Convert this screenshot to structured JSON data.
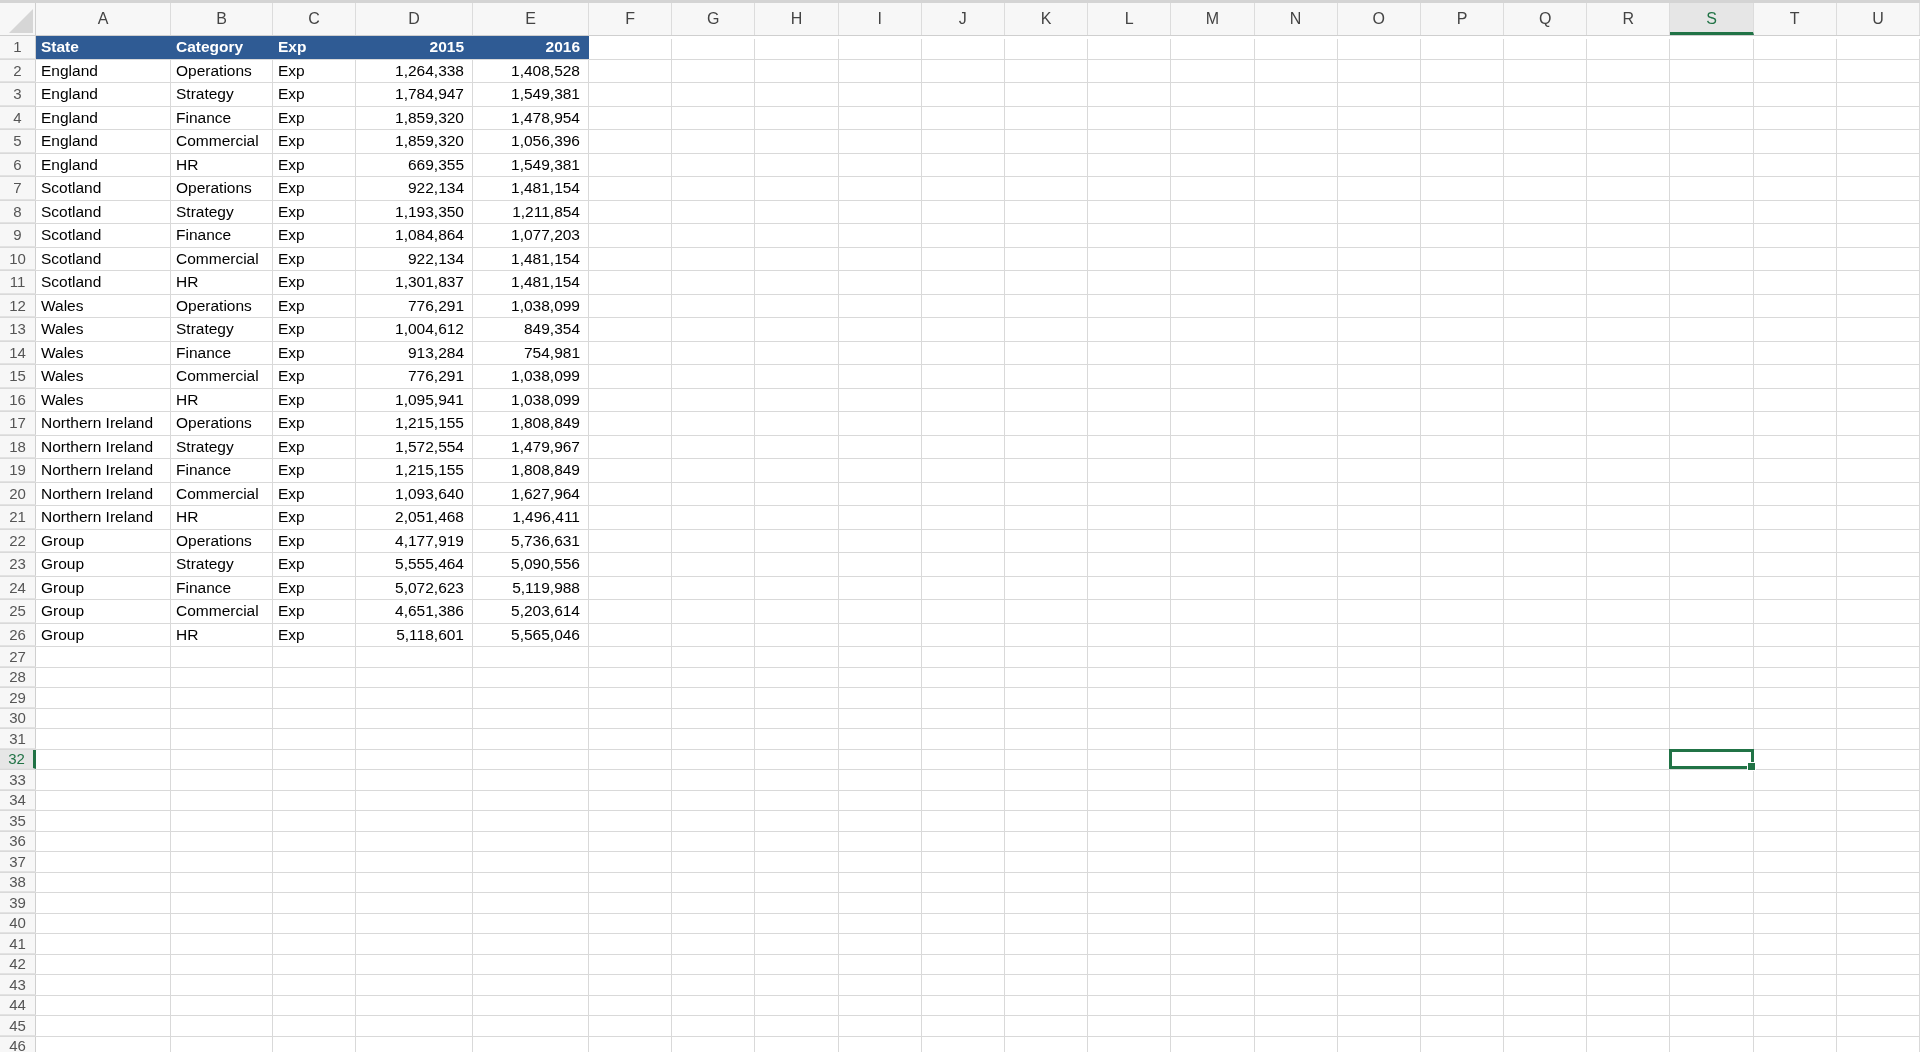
{
  "columns": [
    {
      "label": "A",
      "selected": false
    },
    {
      "label": "B",
      "selected": false
    },
    {
      "label": "C",
      "selected": false
    },
    {
      "label": "D",
      "selected": false
    },
    {
      "label": "E",
      "selected": false
    },
    {
      "label": "F",
      "selected": false
    },
    {
      "label": "G",
      "selected": false
    },
    {
      "label": "H",
      "selected": false
    },
    {
      "label": "I",
      "selected": false
    },
    {
      "label": "J",
      "selected": false
    },
    {
      "label": "K",
      "selected": false
    },
    {
      "label": "L",
      "selected": false
    },
    {
      "label": "M",
      "selected": false
    },
    {
      "label": "N",
      "selected": false
    },
    {
      "label": "O",
      "selected": false
    },
    {
      "label": "P",
      "selected": false
    },
    {
      "label": "Q",
      "selected": false
    },
    {
      "label": "R",
      "selected": false
    },
    {
      "label": "S",
      "selected": true
    },
    {
      "label": "T",
      "selected": false
    },
    {
      "label": "U",
      "selected": false
    }
  ],
  "rows": [
    {
      "number": "1",
      "selected": false,
      "kind": "header",
      "cells": [
        "State",
        "Category",
        "Exp",
        "2015",
        "2016"
      ]
    },
    {
      "number": "2",
      "selected": false,
      "kind": "data",
      "cells": [
        "England",
        "Operations",
        "Exp",
        "1,264,338",
        "1,408,528"
      ]
    },
    {
      "number": "3",
      "selected": false,
      "kind": "data",
      "cells": [
        "England",
        "Strategy",
        "Exp",
        "1,784,947",
        "1,549,381"
      ]
    },
    {
      "number": "4",
      "selected": false,
      "kind": "data",
      "cells": [
        "England",
        "Finance",
        "Exp",
        "1,859,320",
        "1,478,954"
      ]
    },
    {
      "number": "5",
      "selected": false,
      "kind": "data",
      "cells": [
        "England",
        "Commercial",
        "Exp",
        "1,859,320",
        "1,056,396"
      ]
    },
    {
      "number": "6",
      "selected": false,
      "kind": "data",
      "cells": [
        "England",
        "HR",
        "Exp",
        "669,355",
        "1,549,381"
      ]
    },
    {
      "number": "7",
      "selected": false,
      "kind": "data",
      "cells": [
        "Scotland",
        "Operations",
        "Exp",
        "922,134",
        "1,481,154"
      ]
    },
    {
      "number": "8",
      "selected": false,
      "kind": "data",
      "cells": [
        "Scotland",
        "Strategy",
        "Exp",
        "1,193,350",
        "1,211,854"
      ]
    },
    {
      "number": "9",
      "selected": false,
      "kind": "data",
      "cells": [
        "Scotland",
        "Finance",
        "Exp",
        "1,084,864",
        "1,077,203"
      ]
    },
    {
      "number": "10",
      "selected": false,
      "kind": "data",
      "cells": [
        "Scotland",
        "Commercial",
        "Exp",
        "922,134",
        "1,481,154"
      ]
    },
    {
      "number": "11",
      "selected": false,
      "kind": "data",
      "cells": [
        "Scotland",
        "HR",
        "Exp",
        "1,301,837",
        "1,481,154"
      ]
    },
    {
      "number": "12",
      "selected": false,
      "kind": "data",
      "cells": [
        "Wales",
        "Operations",
        "Exp",
        "776,291",
        "1,038,099"
      ]
    },
    {
      "number": "13",
      "selected": false,
      "kind": "data",
      "cells": [
        "Wales",
        "Strategy",
        "Exp",
        "1,004,612",
        "849,354"
      ]
    },
    {
      "number": "14",
      "selected": false,
      "kind": "data",
      "cells": [
        "Wales",
        "Finance",
        "Exp",
        "913,284",
        "754,981"
      ]
    },
    {
      "number": "15",
      "selected": false,
      "kind": "data",
      "cells": [
        "Wales",
        "Commercial",
        "Exp",
        "776,291",
        "1,038,099"
      ]
    },
    {
      "number": "16",
      "selected": false,
      "kind": "data",
      "cells": [
        "Wales",
        "HR",
        "Exp",
        "1,095,941",
        "1,038,099"
      ]
    },
    {
      "number": "17",
      "selected": false,
      "kind": "data",
      "cells": [
        "Northern Ireland",
        "Operations",
        "Exp",
        "1,215,155",
        "1,808,849"
      ]
    },
    {
      "number": "18",
      "selected": false,
      "kind": "data",
      "cells": [
        "Northern Ireland",
        "Strategy",
        "Exp",
        "1,572,554",
        "1,479,967"
      ]
    },
    {
      "number": "19",
      "selected": false,
      "kind": "data",
      "cells": [
        "Northern Ireland",
        "Finance",
        "Exp",
        "1,215,155",
        "1,808,849"
      ]
    },
    {
      "number": "20",
      "selected": false,
      "kind": "data",
      "cells": [
        "Northern Ireland",
        "Commercial",
        "Exp",
        "1,093,640",
        "1,627,964"
      ]
    },
    {
      "number": "21",
      "selected": false,
      "kind": "data",
      "cells": [
        "Northern Ireland",
        "HR",
        "Exp",
        "2,051,468",
        "1,496,411"
      ]
    },
    {
      "number": "22",
      "selected": false,
      "kind": "data",
      "cells": [
        "Group",
        "Operations",
        "Exp",
        "4,177,919",
        "5,736,631"
      ]
    },
    {
      "number": "23",
      "selected": false,
      "kind": "data",
      "cells": [
        "Group",
        "Strategy",
        "Exp",
        "5,555,464",
        "5,090,556"
      ]
    },
    {
      "number": "24",
      "selected": false,
      "kind": "data",
      "cells": [
        "Group",
        "Finance",
        "Exp",
        "5,072,623",
        "5,119,988"
      ]
    },
    {
      "number": "25",
      "selected": false,
      "kind": "data",
      "cells": [
        "Group",
        "Commercial",
        "Exp",
        "4,651,386",
        "5,203,614"
      ]
    },
    {
      "number": "26",
      "selected": false,
      "kind": "data",
      "cells": [
        "Group",
        "HR",
        "Exp",
        "5,118,601",
        "5,565,046"
      ]
    },
    {
      "number": "27",
      "selected": false,
      "kind": "empty"
    },
    {
      "number": "28",
      "selected": false,
      "kind": "empty"
    },
    {
      "number": "29",
      "selected": false,
      "kind": "empty"
    },
    {
      "number": "30",
      "selected": false,
      "kind": "empty"
    },
    {
      "number": "31",
      "selected": false,
      "kind": "empty"
    },
    {
      "number": "32",
      "selected": true,
      "kind": "empty"
    },
    {
      "number": "33",
      "selected": false,
      "kind": "empty"
    },
    {
      "number": "34",
      "selected": false,
      "kind": "empty"
    },
    {
      "number": "35",
      "selected": false,
      "kind": "empty"
    },
    {
      "number": "36",
      "selected": false,
      "kind": "empty"
    },
    {
      "number": "37",
      "selected": false,
      "kind": "empty"
    },
    {
      "number": "38",
      "selected": false,
      "kind": "empty"
    },
    {
      "number": "39",
      "selected": false,
      "kind": "empty"
    },
    {
      "number": "40",
      "selected": false,
      "kind": "empty"
    },
    {
      "number": "41",
      "selected": false,
      "kind": "empty"
    },
    {
      "number": "42",
      "selected": false,
      "kind": "empty"
    },
    {
      "number": "43",
      "selected": false,
      "kind": "empty"
    },
    {
      "number": "44",
      "selected": false,
      "kind": "empty"
    },
    {
      "number": "45",
      "selected": false,
      "kind": "empty"
    },
    {
      "number": "46",
      "selected": false,
      "kind": "empty"
    }
  ]
}
